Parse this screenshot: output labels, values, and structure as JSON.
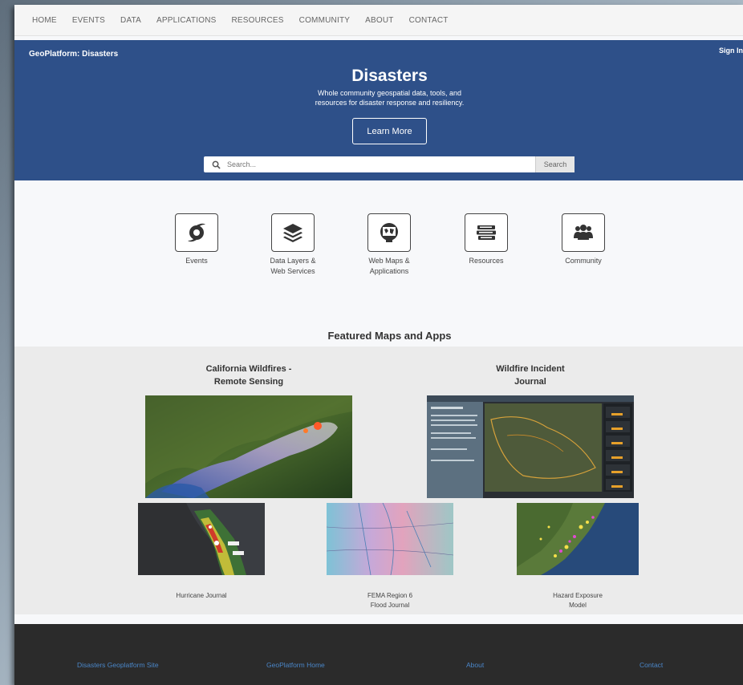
{
  "nav": [
    "HOME",
    "EVENTS",
    "DATA",
    "APPLICATIONS",
    "RESOURCES",
    "COMMUNITY",
    "ABOUT",
    "CONTACT"
  ],
  "hero": {
    "brand": "GeoPlatform: Disasters",
    "signin": "Sign In",
    "title": "Disasters",
    "subtitle_line1": "Whole community geospatial data, tools, and",
    "subtitle_line2": "resources for disaster response and resiliency.",
    "learn_more": "Learn More"
  },
  "search": {
    "placeholder": "Search...",
    "button": "Search"
  },
  "categories": [
    {
      "line1": "Events",
      "line2": "",
      "icon": "hurricane-icon"
    },
    {
      "line1": "Data Layers &",
      "line2": "Web Services",
      "icon": "layers-icon"
    },
    {
      "line1": "Web Maps &",
      "line2": "Applications",
      "icon": "web-map-icon"
    },
    {
      "line1": "Resources",
      "line2": "",
      "icon": "books-icon"
    },
    {
      "line1": "Community",
      "line2": "",
      "icon": "people-icon"
    }
  ],
  "featured": {
    "title": "Featured Maps and Apps",
    "items": [
      {
        "title_line1": "California Wildfires -",
        "title_line2": "Remote Sensing"
      },
      {
        "title_line1": "Wildfire Incident",
        "title_line2": "Journal"
      },
      {
        "caption_line1": "Hurricane Journal",
        "caption_line2": ""
      },
      {
        "caption_line1": "FEMA Region 6",
        "caption_line2": "Flood Journal"
      },
      {
        "caption_line1": "Hazard Exposure",
        "caption_line2": "Model"
      }
    ]
  },
  "footer": [
    "Disasters Geoplatform Site",
    "GeoPlatform Home",
    "About",
    "Contact"
  ],
  "colors": {
    "hero": "#2e5089",
    "footer": "#2b2b2b",
    "footer_link": "#4a86c8"
  }
}
